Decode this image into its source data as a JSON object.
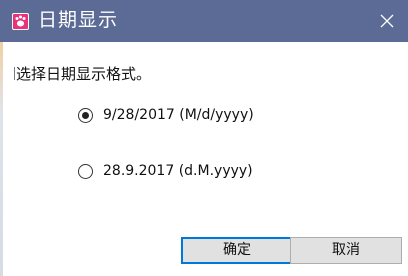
{
  "window": {
    "title": "日期显示",
    "app_icon": "paw-icon",
    "close_icon": "close-icon",
    "title_color": "#5c6b95"
  },
  "dialog": {
    "prompt": "选择日期显示格式。",
    "options": [
      {
        "label": "9/28/2017 (M/d/yyyy)",
        "selected": true
      },
      {
        "label": "28.9.2017 (d.M.yyyy)",
        "selected": false
      }
    ],
    "buttons": {
      "ok": "确定",
      "cancel": "取消"
    }
  }
}
